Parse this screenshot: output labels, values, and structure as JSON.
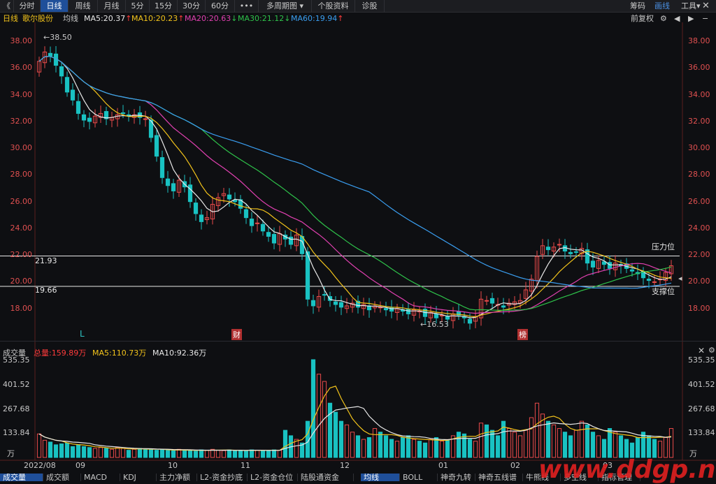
{
  "toolbar": {
    "tabs": [
      "分时",
      "日线",
      "周线",
      "月线",
      "5分",
      "15分",
      "30分",
      "60分",
      "•••",
      "多周期图",
      "个股资料",
      "诊股"
    ],
    "active_tab": "日线",
    "right": [
      "筹码",
      "画线",
      "工具"
    ]
  },
  "ma_bar": {
    "period": "日线",
    "name": "歌尔股份",
    "label": "均线",
    "ma5": "MA5:20.37",
    "ma10": "MA10:20.23",
    "ma20": "MA20:20.63",
    "ma30": "MA30:21.12",
    "ma60": "MA60:19.94",
    "fq": "前复权",
    "colors": {
      "ma5": "#e8e8e8",
      "ma10": "#f2c31b",
      "ma20": "#e040b0",
      "ma30": "#2ec24a",
      "ma60": "#3a9ef0"
    }
  },
  "price_axis": [
    "38.00",
    "36.00",
    "34.00",
    "32.00",
    "30.00",
    "28.00",
    "26.00",
    "24.00",
    "22.00",
    "20.00",
    "18.00"
  ],
  "annotations": {
    "high": "38.50",
    "low": "16.53",
    "resistance_value": "21.93",
    "resistance_label": "压力位",
    "support_value": "19.66",
    "support_label": "支撑位",
    "marker_l": "L",
    "marker_cai": "财",
    "marker_bang": "榜"
  },
  "volume_bar": {
    "title": "成交量",
    "total": "总量:159.89万",
    "ma5": "MA5:110.73万",
    "ma10": "MA10:92.36万"
  },
  "volume_axis": [
    "535.35",
    "401.52",
    "267.68",
    "133.84"
  ],
  "volume_unit": "万",
  "x_axis": [
    "2022/08",
    "09",
    "10",
    "11",
    "12",
    "01",
    "02",
    "03"
  ],
  "bottom_tabs": [
    "成交量",
    "成交额",
    "MACD",
    "KDJ",
    "主力净额",
    "L2-资金抄底",
    "L2-资金仓位",
    "陆股通资金"
  ],
  "bottom_tabs2": [
    "均线",
    "BOLL",
    "神奇九转",
    "神奇五线谱",
    "牛熊线",
    "多空线",
    "指标管理"
  ],
  "active_bottom": "成交量",
  "watermark": "www.ddgp.net",
  "chart_data": {
    "type": "candlestick",
    "title": "",
    "price_range": [
      16.0,
      39.0
    ],
    "volume_range": [
      0,
      540
    ],
    "closes": [
      36.5,
      37.2,
      36.9,
      36.2,
      35.4,
      34.2,
      33.6,
      32.6,
      32.1,
      32.0,
      32.4,
      32.6,
      32.2,
      32.3,
      32.5,
      32.6,
      32.4,
      32.5,
      32.3,
      32.2,
      30.8,
      29.4,
      27.8,
      27.2,
      26.8,
      27.6,
      27.1,
      26.0,
      25.1,
      24.5,
      24.8,
      25.8,
      26.3,
      26.6,
      26.2,
      26.0,
      25.5,
      24.8,
      24.2,
      24.4,
      23.8,
      23.4,
      22.9,
      23.6,
      23.2,
      22.8,
      23.5,
      22.1,
      18.7,
      18.2,
      18.9,
      19.0,
      18.6,
      18.3,
      18.1,
      18.2,
      18.4,
      18.1,
      18.3,
      17.9,
      18.2,
      18.1,
      17.9,
      17.8,
      18.0,
      17.8,
      17.6,
      17.9,
      17.8,
      17.4,
      17.7,
      17.3,
      17.5,
      17.2,
      17.6,
      17.5,
      17.3,
      16.9,
      17.4,
      18.7,
      18.6,
      18.4,
      18.3,
      18.1,
      18.4,
      18.5,
      18.6,
      19.4,
      20.2,
      21.9,
      22.7,
      22.4,
      22.6,
      22.8,
      22.3,
      22.1,
      22.2,
      22.5,
      21.4,
      21.1,
      21.6,
      21.3,
      21.0,
      21.4,
      21.2,
      21.0,
      20.8,
      20.6,
      20.3,
      20.1,
      20.0,
      20.2,
      20.7,
      21.2
    ],
    "volumes": [
      130,
      95,
      85,
      70,
      75,
      80,
      60,
      70,
      60,
      55,
      50,
      55,
      50,
      45,
      55,
      50,
      40,
      45,
      50,
      48,
      45,
      40,
      42,
      40,
      38,
      45,
      38,
      40,
      35,
      42,
      40,
      45,
      40,
      38,
      42,
      35,
      40,
      38,
      42,
      40,
      36,
      38,
      42,
      40,
      150,
      120,
      100,
      80,
      200,
      540,
      460,
      420,
      300,
      250,
      200,
      180,
      140,
      120,
      100,
      110,
      160,
      140,
      120,
      100,
      90,
      110,
      120,
      100,
      90,
      80,
      100,
      110,
      90,
      95,
      120,
      140,
      130,
      100,
      90,
      190,
      180,
      150,
      120,
      200,
      160,
      140,
      120,
      150,
      220,
      300,
      240,
      200,
      180,
      160,
      140,
      120,
      150,
      200,
      180,
      140,
      120,
      100,
      160,
      140,
      120,
      100,
      80,
      110,
      140,
      120,
      100,
      90,
      110,
      160
    ],
    "ma_series": [
      "MA5",
      "MA10",
      "MA20",
      "MA30",
      "MA60"
    ],
    "ma_final": {
      "MA5": 20.37,
      "MA10": 20.23,
      "MA20": 20.63,
      "MA30": 21.12,
      "MA60": 19.94
    },
    "horizontal_lines": [
      21.93,
      19.66
    ],
    "volume_ma": {
      "MA5": 110.73,
      "MA10": 92.36
    }
  }
}
